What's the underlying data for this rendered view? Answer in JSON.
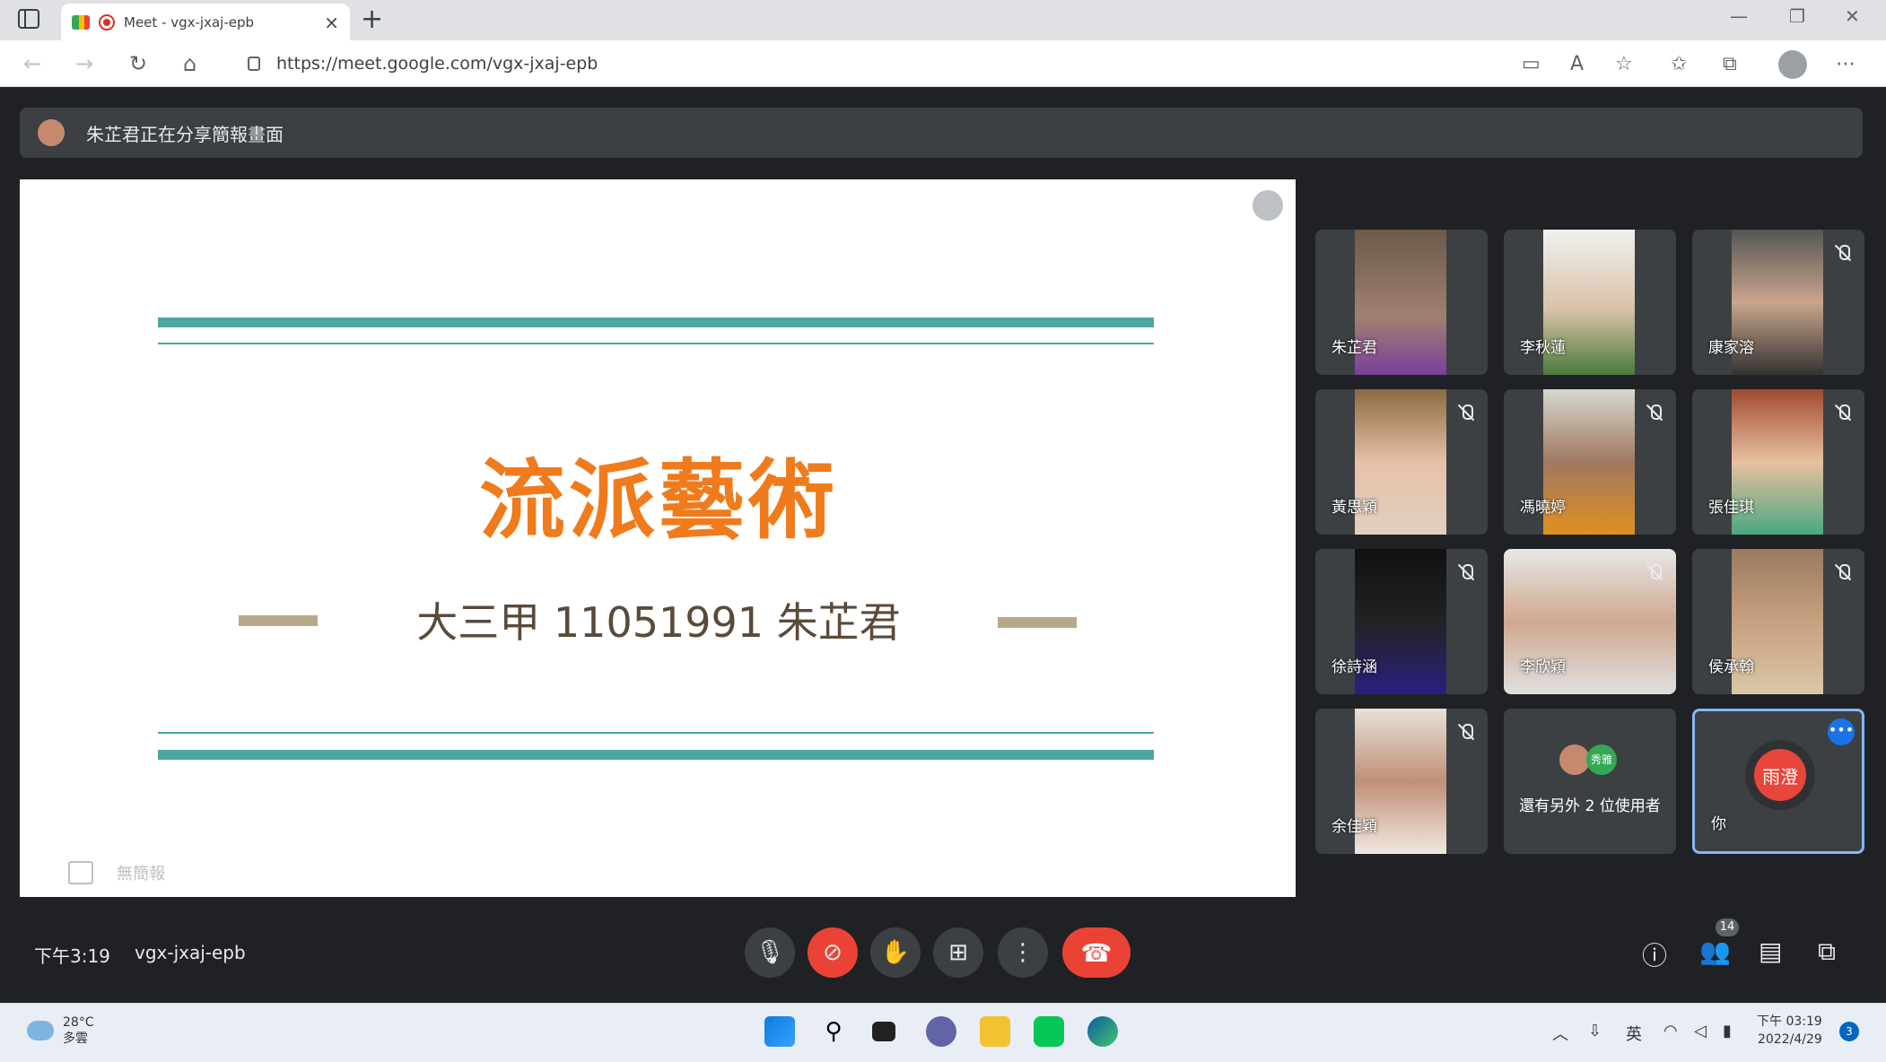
{
  "browser": {
    "tab_title": "Meet - vgx-jxaj-epb",
    "tab_close": "×",
    "new_tab": "+",
    "url": "https://meet.google.com/vgx-jxaj-epb",
    "window_controls": [
      "—",
      "❐",
      "✕"
    ]
  },
  "meet": {
    "presenting_banner": "朱芷君正在分享簡報畫面",
    "slide": {
      "title": "流派藝術",
      "subtitle": "大三甲 11051991 朱芷君"
    },
    "speaker_notes_label": "無簡報",
    "participants": [
      {
        "name": "朱芷君",
        "muted": false
      },
      {
        "name": "李秋蓮",
        "muted": false
      },
      {
        "name": "康家溶",
        "muted": true
      },
      {
        "name": "黃思穎",
        "muted": true
      },
      {
        "name": "馮曉婷",
        "muted": true
      },
      {
        "name": "張佳琪",
        "muted": true
      },
      {
        "name": "徐詩涵",
        "muted": true
      },
      {
        "name": "李欣穎",
        "muted": true
      },
      {
        "name": "侯承翰",
        "muted": true
      },
      {
        "name": "余佳穎",
        "muted": true
      }
    ],
    "others_label": "還有另外 2 位使用者",
    "others_avatar_text": "秀雅",
    "self": {
      "label": "你",
      "avatar_text": "雨澄",
      "more": "•••"
    },
    "bottom_bar": {
      "time": "下午3:19",
      "meeting_code": "vgx-jxaj-epb",
      "people_count": "14"
    }
  },
  "taskbar": {
    "temperature": "28°C",
    "weather": "多雲",
    "ime": "英",
    "time": "下午 03:19",
    "date": "2022/4/29",
    "notification_count": "3"
  }
}
